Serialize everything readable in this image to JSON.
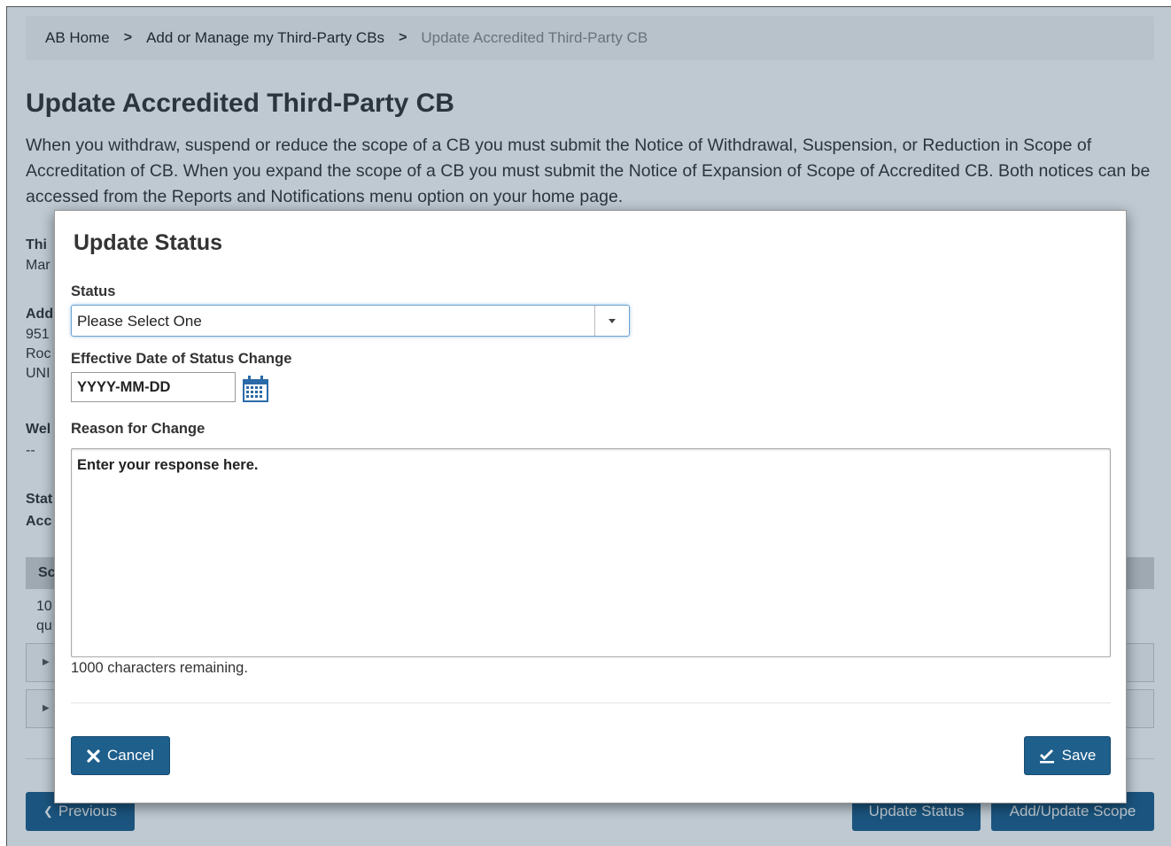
{
  "breadcrumb": {
    "items": [
      "AB Home",
      "Add or Manage my Third-Party CBs",
      "Update Accredited Third-Party CB"
    ],
    "separator": ">"
  },
  "page": {
    "title": "Update Accredited Third-Party CB",
    "intro": "When you withdraw, suspend or reduce the scope of a CB you must submit the Notice of Withdrawal, Suspension, or Reduction in Scope of Accreditation of CB. When you expand the scope of a CB you must submit the Notice of Expansion of Scope of Accredited CB. Both notices can be accessed from the Reports and Notifications menu option on your home page.",
    "partial_fields": {
      "third_party_label": "Thi",
      "third_party_value": "Mar",
      "address_label": "Add",
      "address_line1": "951",
      "address_line2": "Roc",
      "address_line3": "UNI",
      "website_label": "Wel",
      "website_value": "--",
      "status_label_1": "Stat",
      "status_label_2": "Acc",
      "scope_header": "Sc",
      "scope_line1": "10",
      "scope_line2": "qu"
    },
    "buttons": {
      "previous": "Previous",
      "update_status": "Update Status",
      "add_update_scope": "Add/Update Scope"
    }
  },
  "modal": {
    "title": "Update Status",
    "status_label": "Status",
    "status_value": "Please Select One",
    "effective_date_label": "Effective Date of Status Change",
    "effective_date_placeholder": "YYYY-MM-DD",
    "reason_label": "Reason for Change",
    "reason_placeholder": "Enter your response here.",
    "remaining_text": "1000 characters remaining.",
    "cancel_label": "Cancel",
    "save_label": "Save"
  },
  "icons": {
    "calendar": "calendar-icon",
    "cancel": "close-icon",
    "save": "check-underline-icon",
    "previous": "chevron-left-circle-icon",
    "dropdown": "caret-down-icon"
  },
  "colors": {
    "primary_button": "#1e5f8c",
    "overlay": "#143c5f",
    "calendar_icon": "#2a6aa8"
  }
}
